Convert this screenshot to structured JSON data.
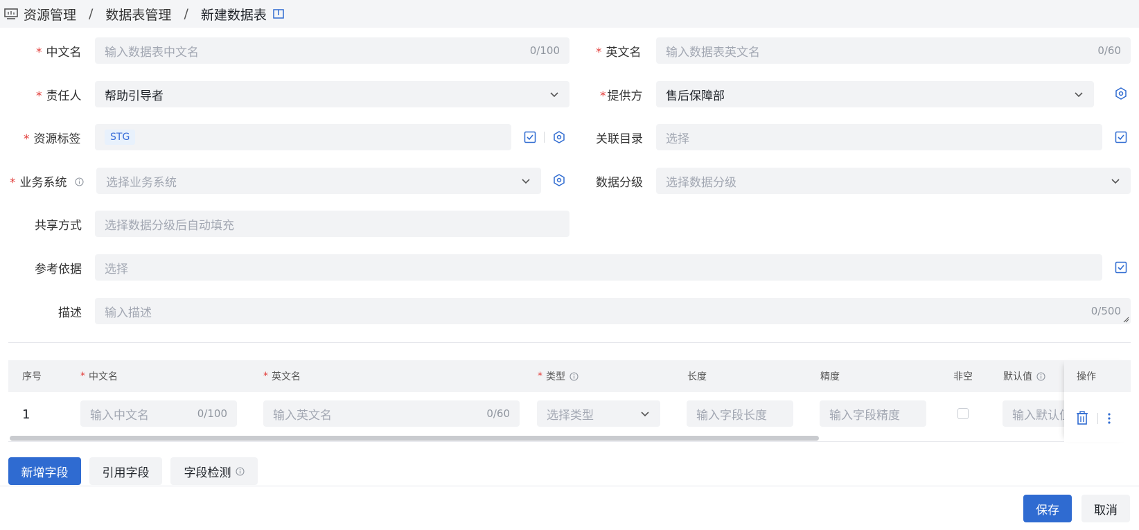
{
  "breadcrumb": {
    "items": [
      "资源管理",
      "数据表管理",
      "新建数据表"
    ],
    "separator": "/"
  },
  "form": {
    "cn_name": {
      "label": "中文名",
      "placeholder": "输入数据表中文名",
      "count": "0/100"
    },
    "en_name": {
      "label": "英文名",
      "placeholder": "输入数据表英文名",
      "count": "0/60"
    },
    "owner": {
      "label": "责任人",
      "value": "帮助引导者"
    },
    "provider": {
      "label": "提供方",
      "value": "售后保障部"
    },
    "resource_tag": {
      "label": "资源标签",
      "tag": "STG"
    },
    "catalog": {
      "label": "关联目录",
      "placeholder": "选择"
    },
    "biz_system": {
      "label": "业务系统",
      "placeholder": "选择业务系统"
    },
    "data_level": {
      "label": "数据分级",
      "placeholder": "选择数据分级"
    },
    "share_mode": {
      "label": "共享方式",
      "placeholder": "选择数据分级后自动填充"
    },
    "reference": {
      "label": "参考依据",
      "placeholder": "选择"
    },
    "description": {
      "label": "描述",
      "placeholder": "输入描述",
      "count": "0/500"
    }
  },
  "table": {
    "headers": {
      "index": "序号",
      "cn_name": "中文名",
      "en_name": "英文名",
      "type": "类型",
      "length": "长度",
      "precision": "精度",
      "not_null": "非空",
      "default": "默认值",
      "actions": "操作"
    },
    "rows": [
      {
        "index": "1",
        "cn_name_placeholder": "输入中文名",
        "cn_name_count": "0/100",
        "en_name_placeholder": "输入英文名",
        "en_name_count": "0/60",
        "type_placeholder": "选择类型",
        "length_placeholder": "输入字段长度",
        "precision_placeholder": "输入字段精度",
        "default_placeholder": "输入默认值"
      }
    ]
  },
  "field_buttons": {
    "add": "新增字段",
    "reference": "引用字段",
    "check": "字段检测"
  },
  "footer": {
    "save": "保存",
    "cancel": "取消"
  },
  "colors": {
    "accent": "#2f6bd1",
    "required": "#e23c39"
  }
}
